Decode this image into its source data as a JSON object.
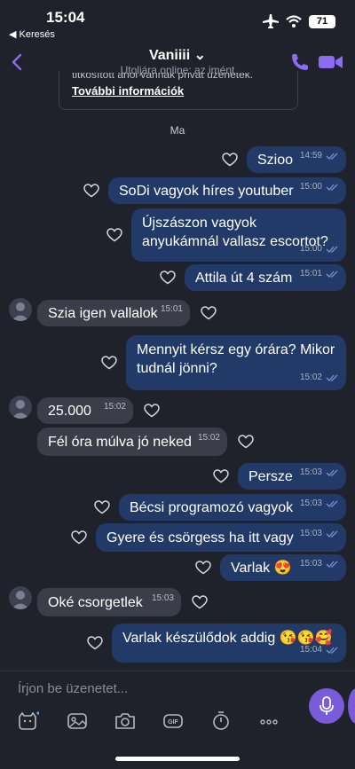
{
  "status": {
    "time": "15:04",
    "back_app": "◀ Keresés",
    "battery": "71"
  },
  "header": {
    "name": "Vaniiii ⌄",
    "subtitle": "Utoljára online: az imént"
  },
  "info": {
    "cut_text": "titkosított ahol vannak privát üzenetek.",
    "link": "További információk"
  },
  "date_separator": "Ma",
  "messages": [
    {
      "dir": "out",
      "text": "Szioo",
      "time": "14:59"
    },
    {
      "dir": "out",
      "text": "SoDi vagyok híres youtuber",
      "time": "15:00"
    },
    {
      "dir": "out",
      "text": "Újszászon vagyok anyukámnál vallasz escortot?",
      "time": "15:00"
    },
    {
      "dir": "out",
      "text": "Attila út 4 szám",
      "time": "15:01"
    },
    {
      "dir": "in",
      "text": "Szia igen vallalok",
      "time": "15:01"
    },
    {
      "dir": "out",
      "text": "Mennyit kérsz egy órára? Mikor tudnál jönni?",
      "time": "15:02"
    },
    {
      "dir": "in",
      "text": "25.000",
      "time": "15:02"
    },
    {
      "dir": "in",
      "text": "Fél óra múlva jó neked",
      "time": "15:02"
    },
    {
      "dir": "out",
      "text": "Persze",
      "time": "15:03"
    },
    {
      "dir": "out",
      "text": "Bécsi programozó vagyok",
      "time": "15:03"
    },
    {
      "dir": "out",
      "text": "Gyere és csörgess ha itt vagy",
      "time": "15:03"
    },
    {
      "dir": "out",
      "text": "Varlak 😍",
      "time": "15:03"
    },
    {
      "dir": "in",
      "text": "Oké csorgetlek",
      "time": "15:03"
    },
    {
      "dir": "out",
      "text": "Varlak készülődok addig 😘😘🥰",
      "time": "15:04"
    }
  ],
  "composer": {
    "placeholder": "Írjon be üzenetet..."
  },
  "colors": {
    "accent": "#7a5bd9",
    "outgoing": "#223a67",
    "incoming": "#3b3e48",
    "background": "#1f222b"
  }
}
